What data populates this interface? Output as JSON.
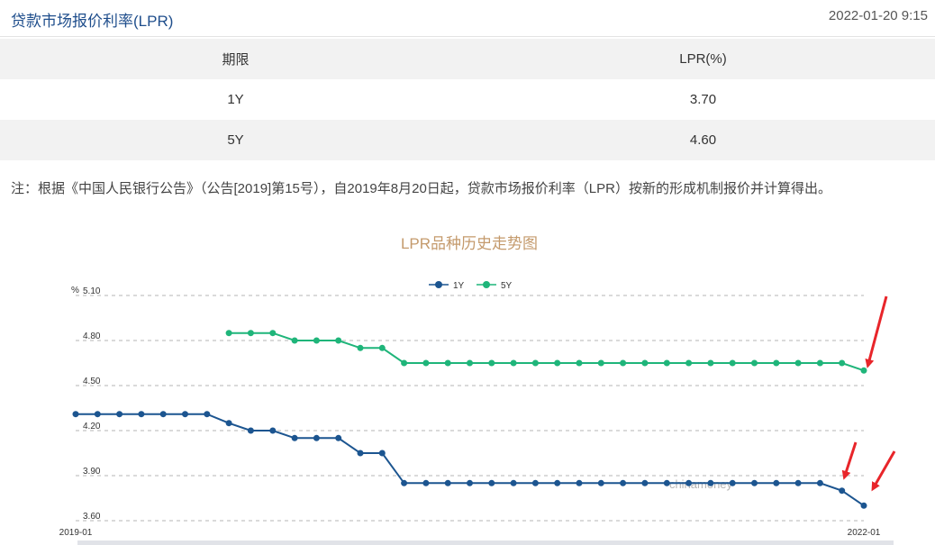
{
  "header": {
    "title": "贷款市场报价利率(LPR)",
    "timestamp": "2022-01-20 9:15"
  },
  "rate_table": {
    "columns": [
      "期限",
      "LPR(%)"
    ],
    "rows": [
      {
        "term": "1Y",
        "rate": "3.70"
      },
      {
        "term": "5Y",
        "rate": "4.60"
      }
    ]
  },
  "note": "注：根据《中国人民银行公告》（公告[2019]第15号），自2019年8月20日起，贷款市场报价利率（LPR）按新的形成机制报价并计算得出。",
  "chart_data": {
    "type": "line",
    "title": "LPR品种历史走势图",
    "ylabel": "%",
    "xlabel": "",
    "ylim": [
      3.6,
      5.1
    ],
    "yticks": [
      "5.10",
      "4.80",
      "4.50",
      "4.20",
      "3.90",
      "3.60"
    ],
    "x_tick_labels": [
      "2019-01",
      "2022-01"
    ],
    "grid": true,
    "legend_position": "top-center",
    "watermark": "chinamoney",
    "categories": [
      "2019-01",
      "2019-02",
      "2019-03",
      "2019-04",
      "2019-05",
      "2019-06",
      "2019-07",
      "2019-08",
      "2019-09",
      "2019-10",
      "2019-11",
      "2019-12",
      "2020-01",
      "2020-02",
      "2020-03",
      "2020-04",
      "2020-05",
      "2020-06",
      "2020-07",
      "2020-08",
      "2020-09",
      "2020-10",
      "2020-11",
      "2020-12",
      "2021-01",
      "2021-02",
      "2021-03",
      "2021-04",
      "2021-05",
      "2021-06",
      "2021-07",
      "2021-08",
      "2021-09",
      "2021-10",
      "2021-11",
      "2021-12",
      "2022-01"
    ],
    "series": [
      {
        "name": "1Y",
        "color": "#1c5590",
        "values": [
          4.31,
          4.31,
          4.31,
          4.31,
          4.31,
          4.31,
          4.31,
          4.25,
          4.2,
          4.2,
          4.15,
          4.15,
          4.15,
          4.05,
          4.05,
          3.85,
          3.85,
          3.85,
          3.85,
          3.85,
          3.85,
          3.85,
          3.85,
          3.85,
          3.85,
          3.85,
          3.85,
          3.85,
          3.85,
          3.85,
          3.85,
          3.85,
          3.85,
          3.85,
          3.85,
          3.8,
          3.7
        ]
      },
      {
        "name": "5Y",
        "color": "#1fb57a",
        "values": [
          null,
          null,
          null,
          null,
          null,
          null,
          null,
          4.85,
          4.85,
          4.85,
          4.8,
          4.8,
          4.8,
          4.75,
          4.75,
          4.65,
          4.65,
          4.65,
          4.65,
          4.65,
          4.65,
          4.65,
          4.65,
          4.65,
          4.65,
          4.65,
          4.65,
          4.65,
          4.65,
          4.65,
          4.65,
          4.65,
          4.65,
          4.65,
          4.65,
          4.65,
          4.6
        ]
      }
    ]
  }
}
